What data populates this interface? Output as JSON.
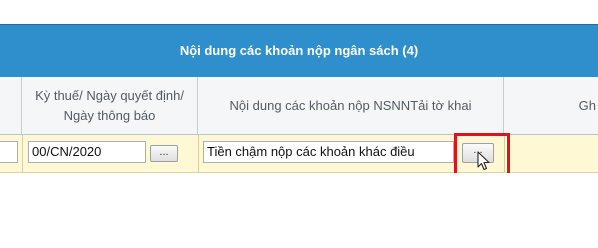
{
  "section": {
    "title": "Nội dung các khoản nộp ngân sách (4)"
  },
  "table": {
    "columns": [
      "",
      "Kỳ thuế/ Ngày quyết định/ Ngày thông báo",
      "Nội dung các khoản nộp NSNNTải tờ khai",
      "Gh"
    ],
    "row": {
      "tax_period": "00/CN/2020",
      "content": "Tiền chậm nộp các khoản khác điều",
      "ellipsis_label": "...",
      "picker_label": "..."
    }
  },
  "colors": {
    "header_band": "#2f8fcc",
    "row_highlight": "#fef9d4",
    "annotation_box": "#e0131b"
  },
  "icons": [
    "mouse-cursor-icon"
  ]
}
